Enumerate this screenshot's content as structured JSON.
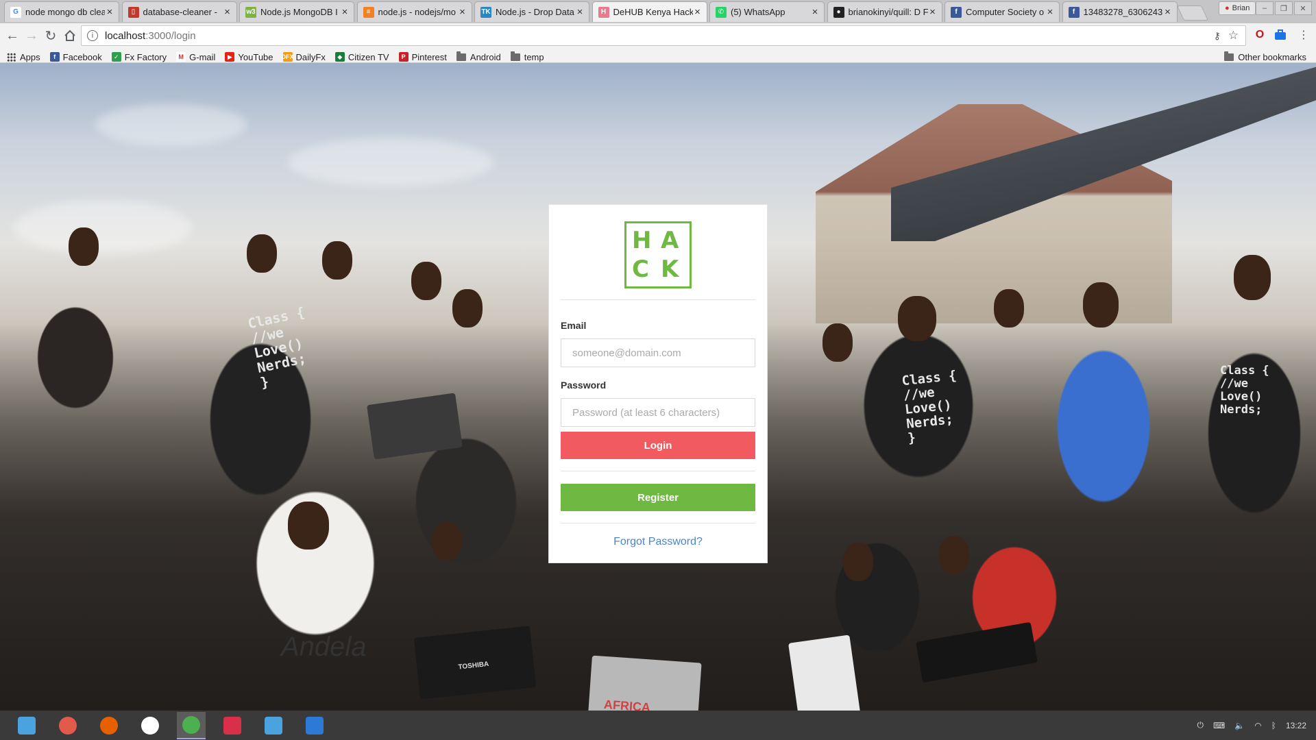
{
  "browser": {
    "tabs": [
      {
        "title": "node mongo db clea",
        "icon_color": "#ffffff",
        "icon_text": "G",
        "icon_fg": "#4285f4",
        "active": false
      },
      {
        "title": "database-cleaner -",
        "icon_color": "#c0392b",
        "icon_text": "▯",
        "icon_fg": "#ffffff",
        "active": false
      },
      {
        "title": "Node.js MongoDB I",
        "icon_color": "#7cb342",
        "icon_text": "w3",
        "icon_fg": "#ffffff",
        "active": false
      },
      {
        "title": "node.js - nodejs/mo",
        "icon_color": "#f48024",
        "icon_text": "≡",
        "icon_fg": "#ffffff",
        "active": false
      },
      {
        "title": "Node.js - Drop Data",
        "icon_color": "#2e86c1",
        "icon_text": "TK",
        "icon_fg": "#ffffff",
        "active": false
      },
      {
        "title": "DeHUB Kenya Hack",
        "icon_color": "#e87a90",
        "icon_text": "H",
        "icon_fg": "#ffffff",
        "active": true
      },
      {
        "title": "(5) WhatsApp",
        "icon_color": "#25d366",
        "icon_text": "✆",
        "icon_fg": "#ffffff",
        "active": false
      },
      {
        "title": "brianokinyi/quill: D F",
        "icon_color": "#222222",
        "icon_text": "●",
        "icon_fg": "#ffffff",
        "active": false
      },
      {
        "title": "Computer Society o",
        "icon_color": "#3b5998",
        "icon_text": "f",
        "icon_fg": "#ffffff",
        "active": false
      },
      {
        "title": "13483278_6306243",
        "icon_color": "#3b5998",
        "icon_text": "f",
        "icon_fg": "#ffffff",
        "active": false
      }
    ],
    "close_glyph": "×",
    "profile_name": "Brian",
    "window_controls": [
      "–",
      "❐",
      "✕"
    ],
    "address": {
      "host": "localhost",
      "path": ":3000/login"
    },
    "bookmarks": [
      {
        "label": "Apps",
        "type": "apps"
      },
      {
        "label": "Facebook",
        "type": "icon",
        "icon_color": "#3b5998",
        "icon_text": "f"
      },
      {
        "label": "Fx Factory",
        "type": "icon",
        "icon_color": "#2e9e4f",
        "icon_text": "✓"
      },
      {
        "label": "G-mail",
        "type": "icon",
        "icon_color": "#ffffff",
        "icon_text": "M",
        "icon_fg": "#d93025"
      },
      {
        "label": "YouTube",
        "type": "icon",
        "icon_color": "#e62117",
        "icon_text": "▶"
      },
      {
        "label": "DailyFx",
        "type": "icon",
        "icon_color": "#f39c12",
        "icon_text": "DFX"
      },
      {
        "label": "Citizen TV",
        "type": "icon",
        "icon_color": "#1c7c3c",
        "icon_text": "◆"
      },
      {
        "label": "Pinterest",
        "type": "icon",
        "icon_color": "#cb2027",
        "icon_text": "P"
      },
      {
        "label": "Android",
        "type": "folder"
      },
      {
        "label": "temp",
        "type": "folder"
      }
    ],
    "other_bookmarks": "Other bookmarks"
  },
  "login": {
    "logo_letters": [
      "H",
      "A",
      "C",
      "K"
    ],
    "email_label": "Email",
    "email_placeholder": "someone@domain.com",
    "password_label": "Password",
    "password_placeholder": "Password (at least 6 characters)",
    "login_button": "Login",
    "register_button": "Register",
    "forgot_link": "Forgot Password?"
  },
  "background": {
    "shirt_texts": [
      "Class {",
      "//we",
      "Love()",
      "Nerds;",
      "}"
    ],
    "andela_text": "Andela",
    "laptop_brand": "TOSHIBA",
    "sticker_text": "AFRICA"
  },
  "taskbar": {
    "apps": [
      {
        "name": "launcher",
        "color": "#4aa3df"
      },
      {
        "name": "recorder",
        "color": "#e25a4a"
      },
      {
        "name": "firefox",
        "color": "#e66000"
      },
      {
        "name": "settings",
        "color": "#ffffff"
      },
      {
        "name": "chrome",
        "color": "#4caf50"
      },
      {
        "name": "terminal",
        "color": "#d9304a"
      },
      {
        "name": "files",
        "color": "#4aa3df"
      },
      {
        "name": "vscode",
        "color": "#2c7ad6"
      }
    ],
    "active_app": "chrome",
    "clock": "13:22"
  }
}
